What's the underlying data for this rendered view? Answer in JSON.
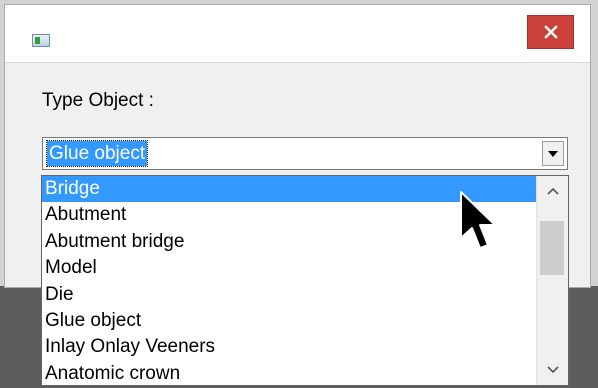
{
  "window": {
    "title": "",
    "icon": "app-window-icon",
    "close_icon": "close-icon",
    "close_color": "#c94139"
  },
  "form": {
    "label": "Type Object :",
    "combo_value": "Glue object"
  },
  "dropdown": {
    "items": [
      "Bridge",
      "Abutment",
      "Abutment bridge",
      "Model",
      "Die",
      "Glue object",
      "Inlay Onlay Veeners",
      "Anatomic crown"
    ],
    "selected_index": 0,
    "highlight_color": "#3399ff",
    "scroll_position": 0.0
  },
  "cursor": {
    "icon": "mouse-pointer-icon"
  }
}
